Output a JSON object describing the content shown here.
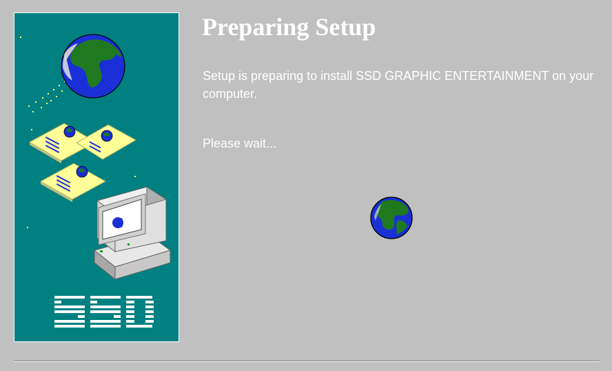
{
  "dialog": {
    "title": "Preparing Setup",
    "description": "Setup is preparing to install SSD GRAPHIC ENTERTAINMENT on your computer.",
    "wait_message": "Please wait..."
  },
  "side_panel": {
    "logo_text": "SSD",
    "background_color": "#008080",
    "icons": [
      "globe-icon",
      "document-icon",
      "computer-icon"
    ]
  },
  "progress": {
    "indicator": "spinning-globe-icon"
  },
  "colors": {
    "window_bg": "#c0c0c0",
    "panel_bg": "#008080",
    "ocean": "#1a2fd6",
    "land": "#1f7a1f",
    "text": "#ffffff"
  }
}
